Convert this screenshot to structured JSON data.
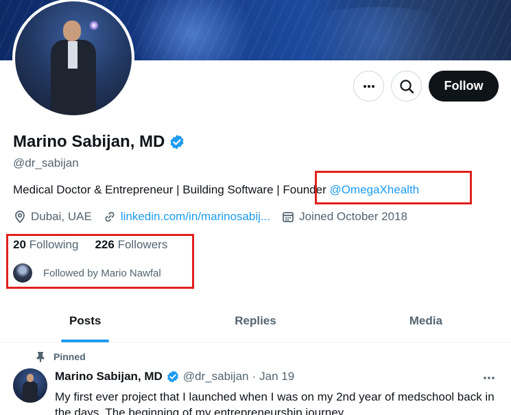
{
  "profile": {
    "name": "Marino Sabijan, MD",
    "handle": "@dr_sabijan",
    "bio_text": "Medical Doctor & Entrepreneur | Building Software | Founder ",
    "bio_link": "@OmegaXhealth",
    "location": "Dubai, UAE",
    "website": "linkedin.com/in/marinosabij...",
    "joined": "Joined October 2018",
    "following_count": "20",
    "following_label": "Following",
    "followers_count": "226",
    "followers_label": "Followers",
    "followed_by": "Followed by Mario Nawfal"
  },
  "actions": {
    "follow_label": "Follow",
    "more_icon": "more-icon",
    "search_icon": "search-icon"
  },
  "tabs": [
    {
      "label": "Posts",
      "active": true
    },
    {
      "label": "Replies",
      "active": false
    },
    {
      "label": "Media",
      "active": false
    }
  ],
  "pinned_post": {
    "pinned_label": "Pinned",
    "author": "Marino Sabijan, MD",
    "handle": "@dr_sabijan",
    "separator": "·",
    "date": "Jan 19",
    "text": "My first ever project that I launched when I was on my 2nd year of medschool back in the days. The beginning of my entrepreneurship journey"
  },
  "colors": {
    "accent": "#1d9bf0",
    "text": "#0f1419",
    "muted": "#536471",
    "highlight": "#e0201c"
  }
}
